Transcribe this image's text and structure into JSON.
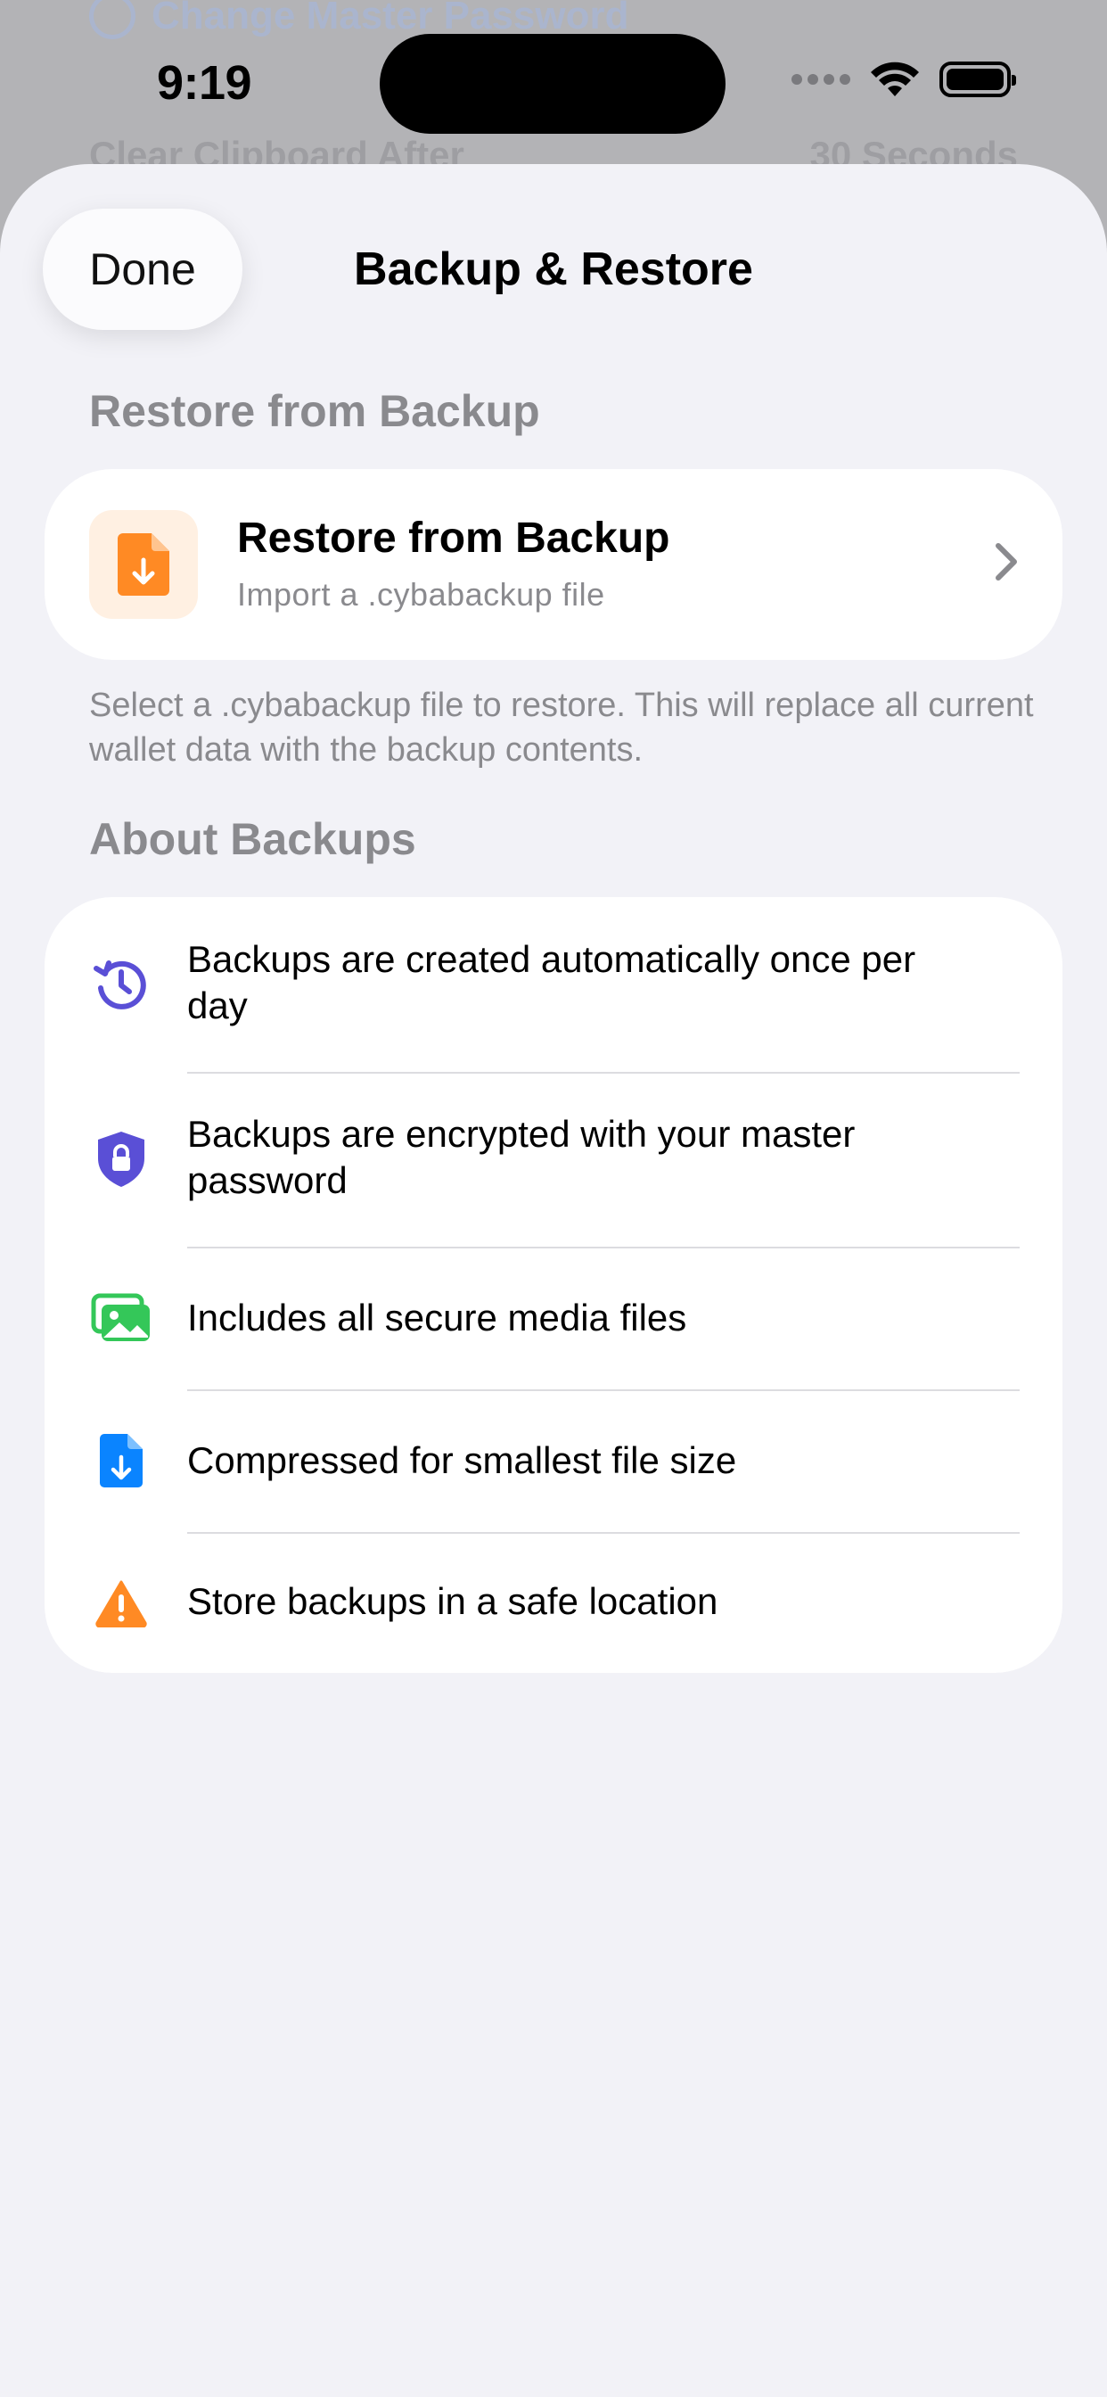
{
  "background": {
    "row1_label": "Change Master Password",
    "row2_label": "Clear Clipboard After",
    "row2_value": "30 Seconds"
  },
  "status_bar": {
    "time": "9:19"
  },
  "sheet": {
    "done_label": "Done",
    "title": "Backup & Restore"
  },
  "restore_section": {
    "header": "Restore from Backup",
    "row": {
      "title": "Restore from Backup",
      "subtitle": "Import a .cybabackup file",
      "icon": "document-download-icon"
    },
    "footnote": "Select a .cybabackup file to restore. This will replace all current wallet data with the backup contents."
  },
  "about_section": {
    "header": "About Backups",
    "items": [
      {
        "icon": "clock-arrow-icon",
        "text": "Backups are created automatically once per day"
      },
      {
        "icon": "lock-shield-icon",
        "text": "Backups are encrypted with your master password"
      },
      {
        "icon": "photos-icon",
        "text": "Includes all secure media files"
      },
      {
        "icon": "document-arrow-icon",
        "text": "Compressed for smallest file size"
      },
      {
        "icon": "warning-triangle-icon",
        "text": "Store backups in a safe location"
      }
    ]
  },
  "colors": {
    "accent_orange": "#FF8A24",
    "indigo": "#5A4FD6",
    "green": "#34C759",
    "blue": "#0A84FF",
    "secondary_text": "#8A8A8E",
    "sheet_background": "#F2F2F7"
  }
}
